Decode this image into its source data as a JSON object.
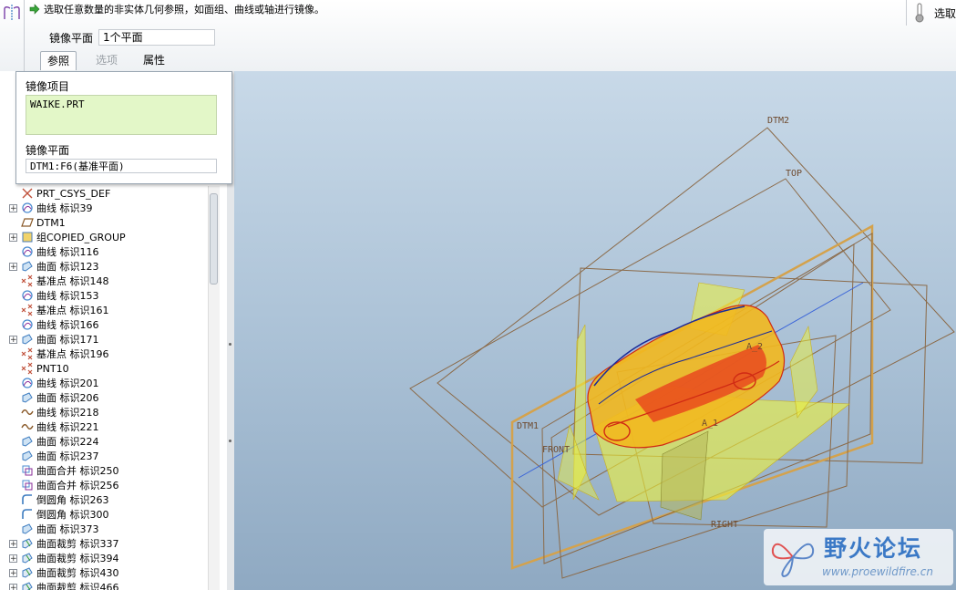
{
  "dashboard": {
    "prompt": "选取任意数量的非实体几何参照，如面组、曲线或轴进行镜像。",
    "mirror_plane_label": "镜像平面",
    "mirror_plane_value": "1个平面",
    "tabs": [
      {
        "label": "参照",
        "state": "active"
      },
      {
        "label": "选项",
        "state": "disabled"
      },
      {
        "label": "属性",
        "state": "normal"
      }
    ],
    "select_label": "选取"
  },
  "reference_panel": {
    "items_label": "镜像项目",
    "items_value": "WAIKE.PRT",
    "plane_label": "镜像平面",
    "plane_value": "DTM1:F6(基准平面)"
  },
  "tree": {
    "items": [
      {
        "label": "PRT_CSYS_DEF",
        "icon": "csys-icon",
        "expandable": false
      },
      {
        "label": "曲线 标识39",
        "icon": "curve-icon",
        "expandable": true
      },
      {
        "label": "DTM1",
        "icon": "datum-plane-icon",
        "expandable": false
      },
      {
        "label": "组COPIED_GROUP",
        "icon": "group-icon",
        "expandable": true
      },
      {
        "label": "曲线 标识116",
        "icon": "curve-icon",
        "expandable": false
      },
      {
        "label": "曲面 标识123",
        "icon": "surface-icon",
        "expandable": true
      },
      {
        "label": "基准点 标识148",
        "icon": "datum-point-icon",
        "expandable": false
      },
      {
        "label": "曲线 标识153",
        "icon": "curve-icon",
        "expandable": false
      },
      {
        "label": "基准点 标识161",
        "icon": "datum-point-icon",
        "expandable": false
      },
      {
        "label": "曲线 标识166",
        "icon": "curve-icon",
        "expandable": false
      },
      {
        "label": "曲面 标识171",
        "icon": "surface-icon",
        "expandable": true
      },
      {
        "label": "基准点 标识196",
        "icon": "datum-point-icon",
        "expandable": false
      },
      {
        "label": "PNT10",
        "icon": "datum-point-icon",
        "expandable": false
      },
      {
        "label": "曲线 标识201",
        "icon": "curve-icon",
        "expandable": false
      },
      {
        "label": "曲面 标识206",
        "icon": "surface-icon",
        "expandable": false
      },
      {
        "label": "曲线 标识218",
        "icon": "sketch-curve-icon",
        "expandable": false
      },
      {
        "label": "曲线 标识221",
        "icon": "sketch-curve-icon",
        "expandable": false
      },
      {
        "label": "曲面 标识224",
        "icon": "surface-icon",
        "expandable": false
      },
      {
        "label": "曲面 标识237",
        "icon": "surface-icon",
        "expandable": false
      },
      {
        "label": "曲面合并 标识250",
        "icon": "merge-icon",
        "expandable": false
      },
      {
        "label": "曲面合并 标识256",
        "icon": "merge-icon",
        "expandable": false
      },
      {
        "label": "倒圆角 标识263",
        "icon": "round-icon",
        "expandable": false
      },
      {
        "label": "倒圆角 标识300",
        "icon": "round-icon",
        "expandable": false
      },
      {
        "label": "曲面 标识373",
        "icon": "surface-icon",
        "expandable": false
      },
      {
        "label": "曲面裁剪 标识337",
        "icon": "trim-icon",
        "expandable": true
      },
      {
        "label": "曲面裁剪 标识394",
        "icon": "trim-icon",
        "expandable": true
      },
      {
        "label": "曲面裁剪 标识430",
        "icon": "trim-icon",
        "expandable": true
      },
      {
        "label": "曲面裁剪 标识466",
        "icon": "trim-icon",
        "expandable": true
      }
    ]
  },
  "viewport": {
    "datum_labels": {
      "dtm2": "DTM2",
      "top": "TOP",
      "dtm1": "DTM1",
      "front": "FRONT",
      "right": "RIGHT",
      "axis_a1": "A_1",
      "axis_a2": "A_2"
    }
  },
  "watermark": {
    "text": "野火论坛",
    "url": "www.proewildfire.cn"
  },
  "colors": {
    "background_top": "#c8d9e8",
    "background_bottom": "#8fa9c2",
    "datum_plane": "#8b6a48",
    "highlight_plane": "#d4a24c",
    "surface_yellow": "#eef23a",
    "surface_red": "#e83b1c",
    "watermark_blue": "#3b79c6"
  }
}
